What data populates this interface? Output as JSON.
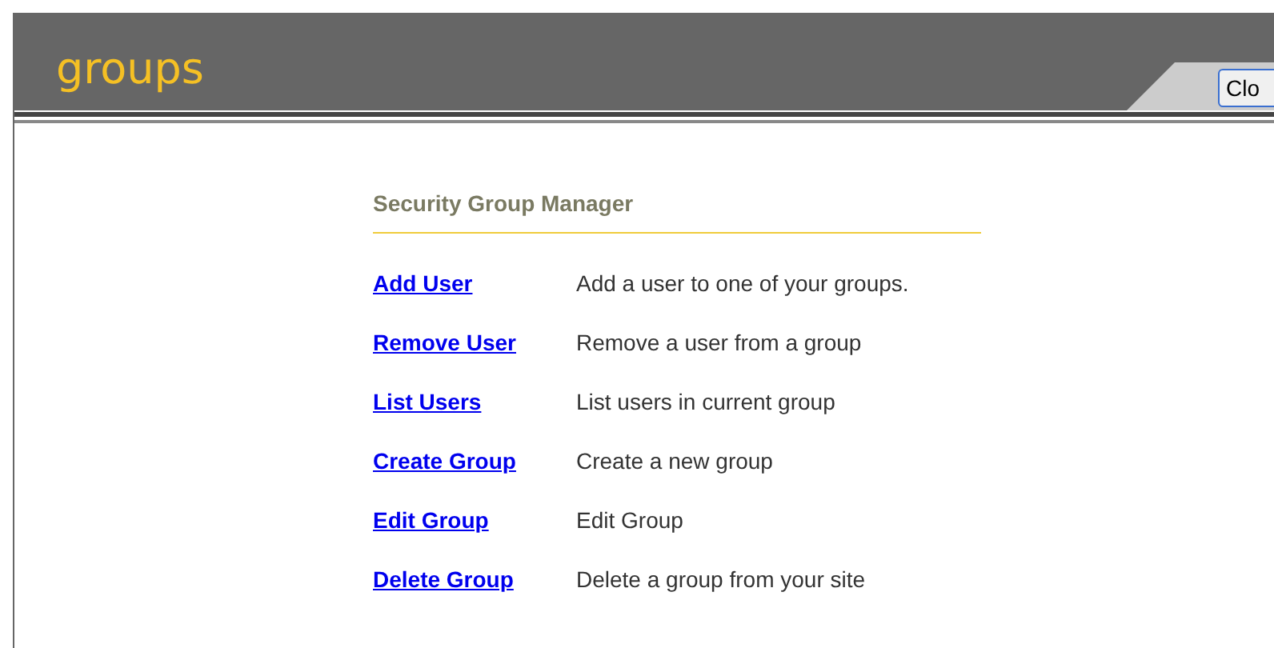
{
  "header": {
    "title": "groups",
    "button": "Clo"
  },
  "panel": {
    "title": "Security Group Manager",
    "actions": [
      {
        "link": "Add User",
        "description": "Add a user to one of your groups."
      },
      {
        "link": "Remove User",
        "description": "Remove a user from a group"
      },
      {
        "link": "List Users",
        "description": "List users in current group"
      },
      {
        "link": "Create Group",
        "description": "Create a new group"
      },
      {
        "link": "Edit Group",
        "description": "Edit Group"
      },
      {
        "link": "Delete Group",
        "description": "Delete a group from your site"
      }
    ]
  }
}
